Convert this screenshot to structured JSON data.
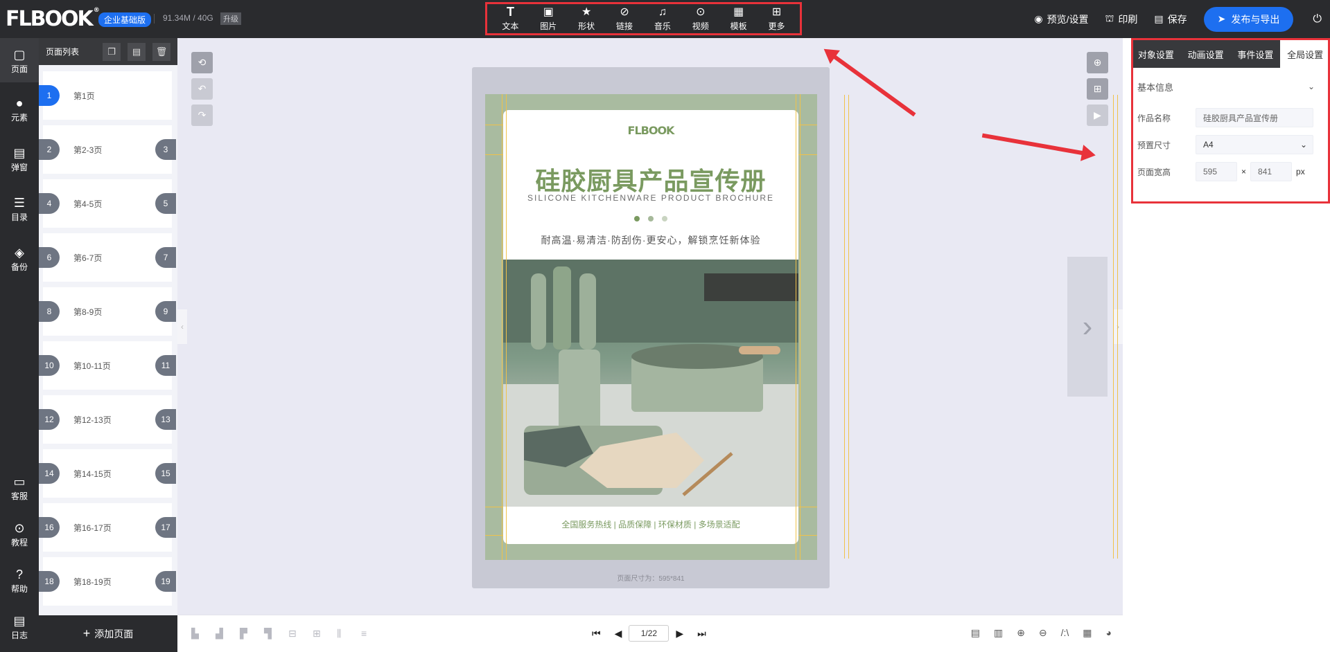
{
  "app": {
    "logo": "FLBOOK",
    "edition": "企业基础版",
    "storage": "91.34M / 40G",
    "upgrade": "升级"
  },
  "toolbar": {
    "tools": [
      {
        "label": "文本",
        "icon": "text-icon"
      },
      {
        "label": "图片",
        "icon": "image-icon"
      },
      {
        "label": "形状",
        "icon": "star-icon"
      },
      {
        "label": "链接",
        "icon": "link-icon"
      },
      {
        "label": "音乐",
        "icon": "music-icon"
      },
      {
        "label": "视频",
        "icon": "video-icon"
      },
      {
        "label": "模板",
        "icon": "template-icon"
      },
      {
        "label": "更多",
        "icon": "more-icon"
      }
    ]
  },
  "top_right": {
    "preview": "预览/设置",
    "print": "印刷",
    "save": "保存",
    "publish": "发布与导出"
  },
  "rail": {
    "items": [
      "页面",
      "元素",
      "弹窗",
      "目录",
      "备份"
    ],
    "bottom": [
      "客服",
      "教程",
      "帮助",
      "日志"
    ]
  },
  "page_list": {
    "title": "页面列表",
    "items": [
      {
        "label": "第1页",
        "left": "1",
        "right": ""
      },
      {
        "label": "第2-3页",
        "left": "2",
        "right": "3"
      },
      {
        "label": "第4-5页",
        "left": "4",
        "right": "5"
      },
      {
        "label": "第6-7页",
        "left": "6",
        "right": "7"
      },
      {
        "label": "第8-9页",
        "left": "8",
        "right": "9"
      },
      {
        "label": "第10-11页",
        "left": "10",
        "right": "11"
      },
      {
        "label": "第12-13页",
        "left": "12",
        "right": "13"
      },
      {
        "label": "第14-15页",
        "left": "14",
        "right": "15"
      },
      {
        "label": "第16-17页",
        "left": "16",
        "right": "17"
      },
      {
        "label": "第18-19页",
        "left": "18",
        "right": "19"
      }
    ],
    "add_page": "添加页面"
  },
  "page": {
    "brand": "FLBOOK",
    "title": "硅胶厨具产品宣传册",
    "subtitle": "SILICONE KITCHENWARE PRODUCT BROCHURE",
    "tagline": "耐高温·易清洁·防刮伤·更安心，解锁烹饪新体验",
    "footer": "全国服务热线 | 品质保障 | 环保材质 | 多场景适配",
    "size_text": "页面尺寸为：595*841"
  },
  "pager": {
    "current": "1/22"
  },
  "settings": {
    "tabs": [
      "对象设置",
      "动画设置",
      "事件设置",
      "全局设置"
    ],
    "active_tab": "全局设置",
    "section": "基本信息",
    "name_label": "作品名称",
    "name_value": "硅胶厨具产品宣传册",
    "preset_label": "预置尺寸",
    "preset_value": "A4",
    "size_label": "页面宽高",
    "width": "595",
    "times": "×",
    "height": "841",
    "unit": "px"
  },
  "colors": {
    "accent": "#1d6ff0",
    "highlight": "#e8323a",
    "brand_green": "#7a9a60"
  }
}
